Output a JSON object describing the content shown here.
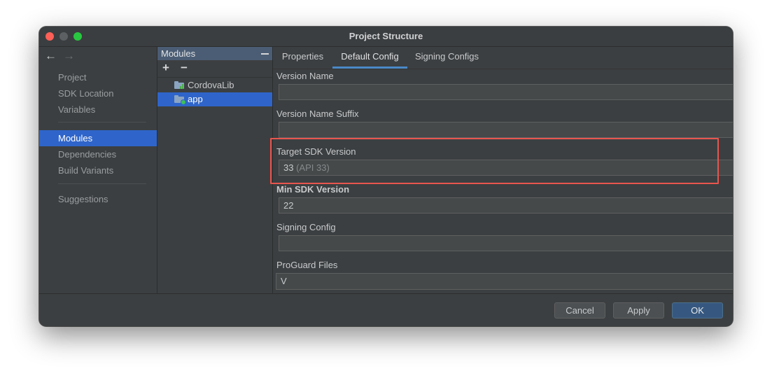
{
  "window": {
    "title": "Project Structure"
  },
  "nav": {
    "items": [
      {
        "label": "Project"
      },
      {
        "label": "SDK Location"
      },
      {
        "label": "Variables"
      },
      {
        "label": "Modules"
      },
      {
        "label": "Dependencies"
      },
      {
        "label": "Build Variants"
      },
      {
        "label": "Suggestions"
      }
    ]
  },
  "modules": {
    "header": "Modules",
    "items": [
      {
        "label": "CordovaLib"
      },
      {
        "label": "app"
      }
    ]
  },
  "tabs": [
    {
      "label": "Properties"
    },
    {
      "label": "Default Config"
    },
    {
      "label": "Signing Configs"
    }
  ],
  "fields": {
    "version_name": {
      "label": "Version Name",
      "value": ""
    },
    "version_name_suffix": {
      "label": "Version Name Suffix",
      "value": ""
    },
    "target_sdk": {
      "label": "Target SDK Version",
      "value": "33",
      "hint": "(API 33)"
    },
    "min_sdk": {
      "label": "Min SDK Version",
      "value": "22"
    },
    "signing_config": {
      "label": "Signing Config",
      "value": ""
    },
    "proguard_files": {
      "label": "ProGuard Files",
      "value": "V"
    }
  },
  "buttons": {
    "cancel": "Cancel",
    "apply": "Apply",
    "ok": "OK"
  },
  "colors": {
    "selection": "#2f65ca",
    "highlight_border": "#e8554e",
    "primary_button": "#365880"
  }
}
